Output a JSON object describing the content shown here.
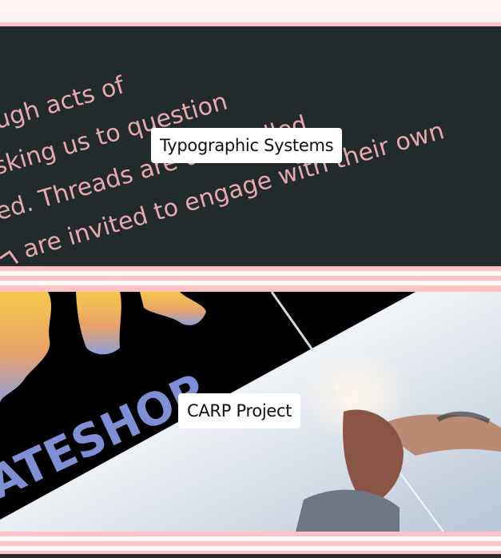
{
  "projects": [
    {
      "title": "Typographic Systems",
      "image_text_lines": [
        "rough acts of",
        "asking us to question",
        "ed. Threads are unravelled",
        "are invited to engage with their own"
      ]
    },
    {
      "title": "CARP Project",
      "image_text": "ATESHOP"
    }
  ],
  "colors": {
    "stripe_pink": "#ffc1c6",
    "page_bg": "#fff3f3",
    "card_dark": "#232a2c",
    "typo_text": "#e6a9b0"
  }
}
